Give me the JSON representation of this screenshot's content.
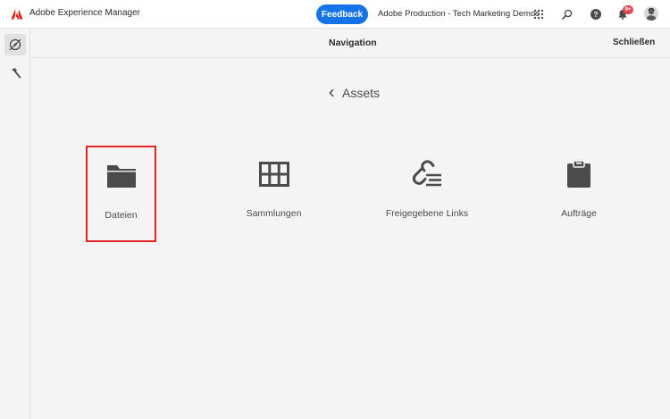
{
  "topbar": {
    "app_title": "Adobe Experience Manager",
    "feedback_label": "Feedback",
    "org_name": "Adobe Production - Tech Marketing Demos",
    "notification_count": "9+",
    "icons": [
      "adobe-logo-icon",
      "apps-grid-icon",
      "search-icon",
      "help-icon",
      "bell-icon",
      "user-avatar"
    ]
  },
  "rail": {
    "items": [
      {
        "icon": "navigation-compass-icon",
        "active": true
      },
      {
        "icon": "tools-hammer-icon",
        "active": false
      }
    ]
  },
  "header": {
    "title": "Navigation",
    "close_label": "Schließen"
  },
  "breadcrumb": {
    "label": "Assets"
  },
  "tiles": [
    {
      "label": "Dateien",
      "icon": "folder-icon",
      "selected": true
    },
    {
      "label": "Sammlungen",
      "icon": "collections-grid-icon",
      "selected": false
    },
    {
      "label": "Freigegebene Links",
      "icon": "shared-link-icon",
      "selected": false
    },
    {
      "label": "Aufträge",
      "icon": "clipboard-icon",
      "selected": false
    }
  ],
  "colors": {
    "accent": "#1473e6",
    "badge": "#e34850",
    "selection": "#e32424",
    "brand": "#eb1000"
  }
}
